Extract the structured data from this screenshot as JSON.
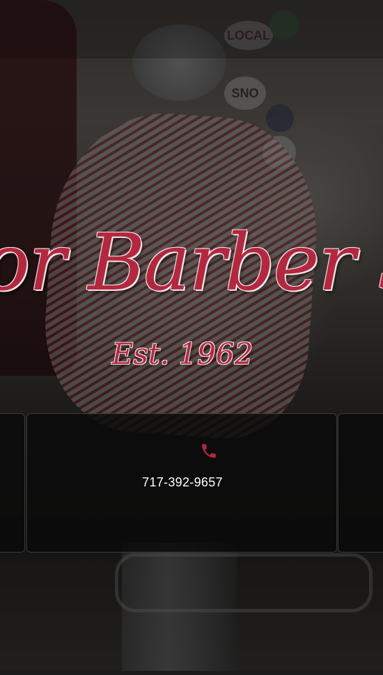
{
  "hero": {
    "title": "Manor Barber Shop",
    "established": "Est. 1962"
  },
  "contact": {
    "phone_icon": "phone-icon",
    "phone_number": "717-392-9657"
  },
  "background_stickers": [
    "LOCAL",
    "SNO"
  ],
  "colors": {
    "brand_red": "#b3283f",
    "card_background": "#0a0a0a",
    "text_white": "#ffffff"
  }
}
